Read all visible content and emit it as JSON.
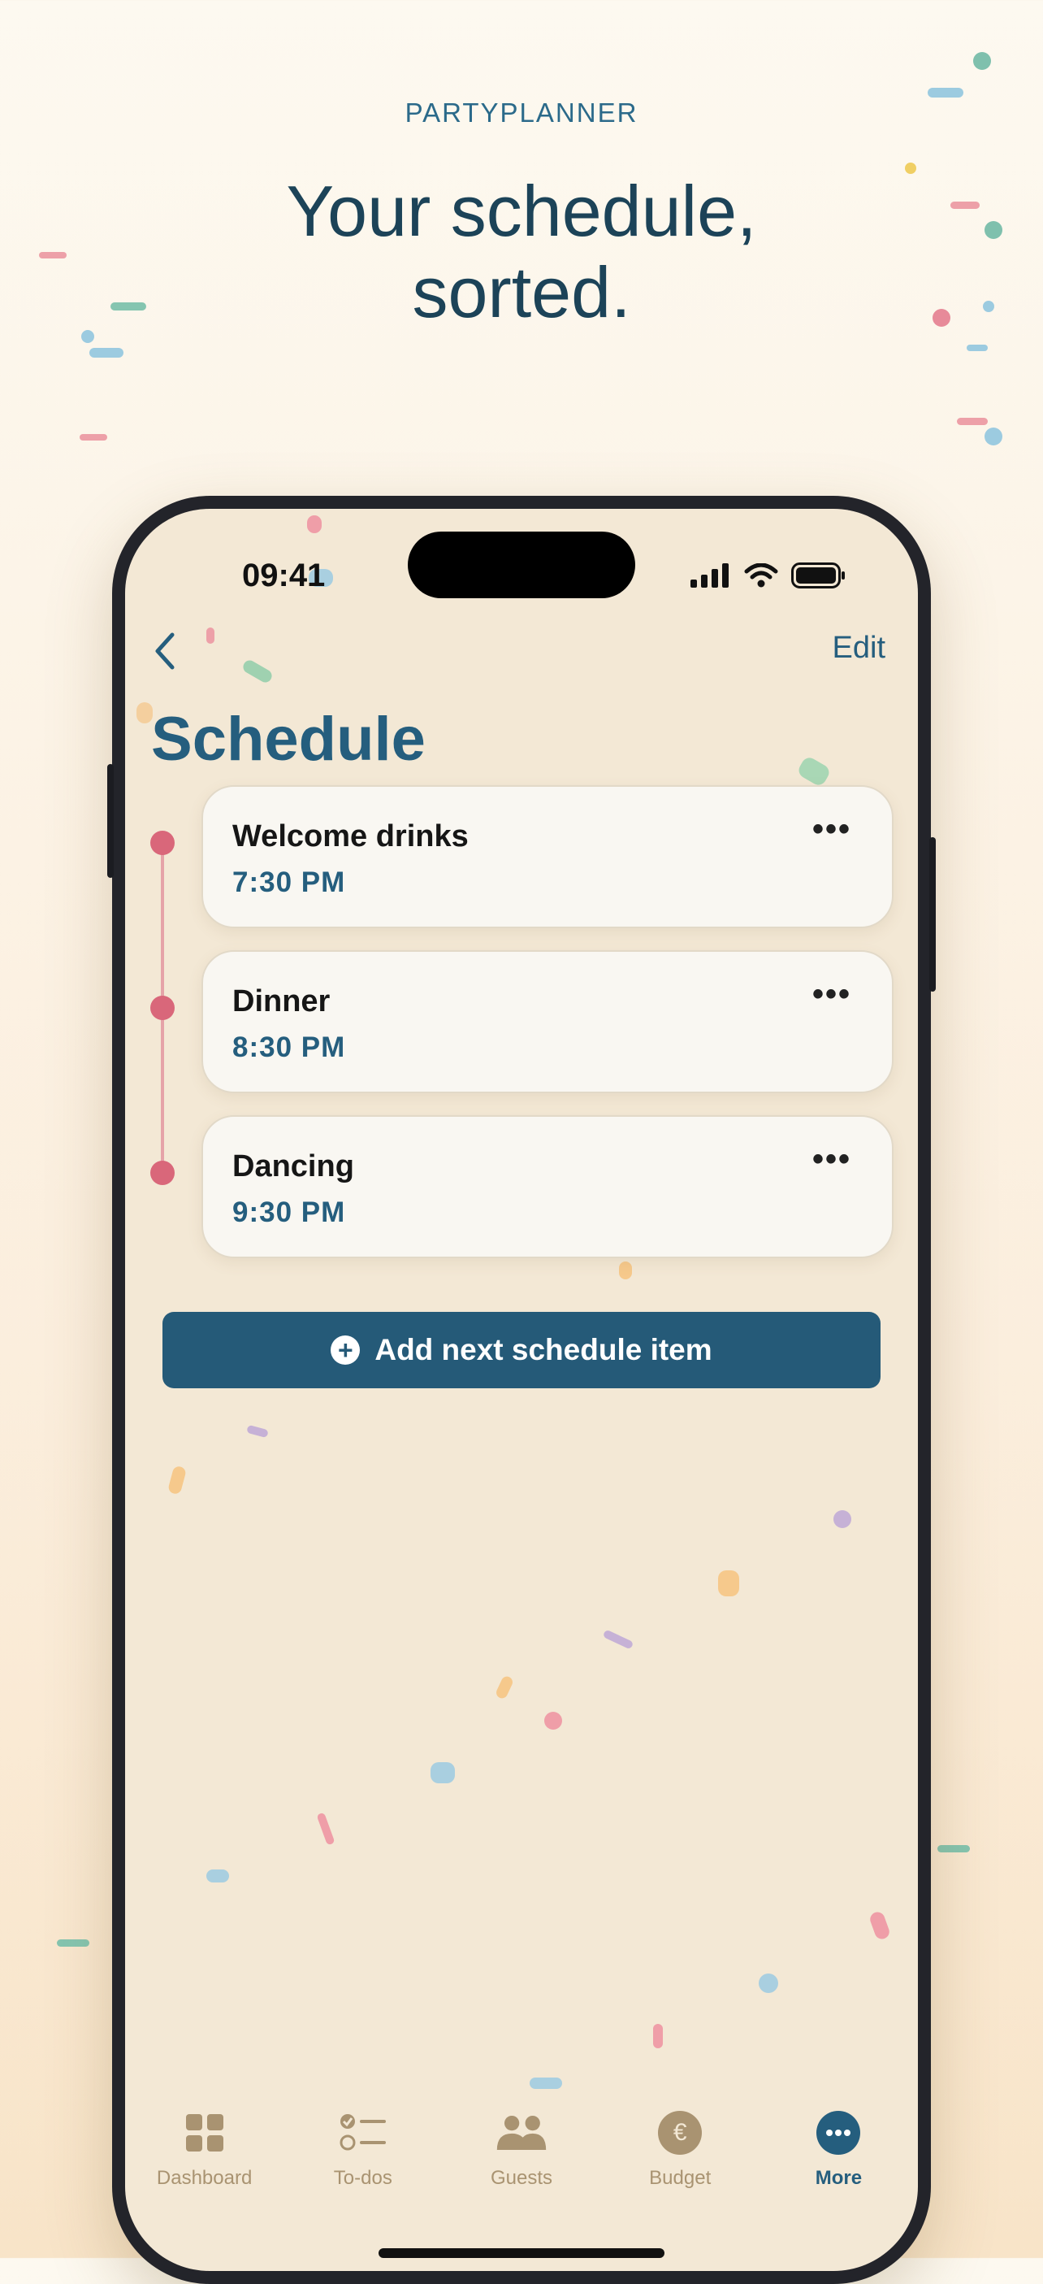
{
  "marketing": {
    "brand": "PARTYPLANNER",
    "headline_line1": "Your schedule,",
    "headline_line2": "sorted."
  },
  "status_bar": {
    "time": "09:41"
  },
  "nav": {
    "back_icon": "chevron-left-icon",
    "edit_label": "Edit"
  },
  "page": {
    "title": "Schedule"
  },
  "schedule": {
    "items": [
      {
        "name": "Welcome drinks",
        "time": "7:30 PM",
        "more_icon": "ellipsis-icon"
      },
      {
        "name": "Dinner",
        "time": "8:30 PM",
        "more_icon": "ellipsis-icon"
      },
      {
        "name": "Dancing",
        "time": "9:30 PM",
        "more_icon": "ellipsis-icon"
      }
    ],
    "more_label": "•••"
  },
  "add_button": {
    "label": "Add next schedule item",
    "icon": "plus-circle-icon"
  },
  "tabbar": {
    "tabs": [
      {
        "label": "Dashboard",
        "icon": "grid-icon",
        "active": false
      },
      {
        "label": "To-dos",
        "icon": "checklist-icon",
        "active": false
      },
      {
        "label": "Guests",
        "icon": "people-icon",
        "active": false
      },
      {
        "label": "Budget",
        "icon": "euro-icon",
        "active": false
      },
      {
        "label": "More",
        "icon": "more-icon",
        "active": true
      }
    ],
    "budget_symbol": "€"
  },
  "colors": {
    "primary": "#255e7e",
    "timeline_dot": "#d9677a",
    "tab_inactive": "#a99371",
    "background": "#f3e8d5"
  }
}
